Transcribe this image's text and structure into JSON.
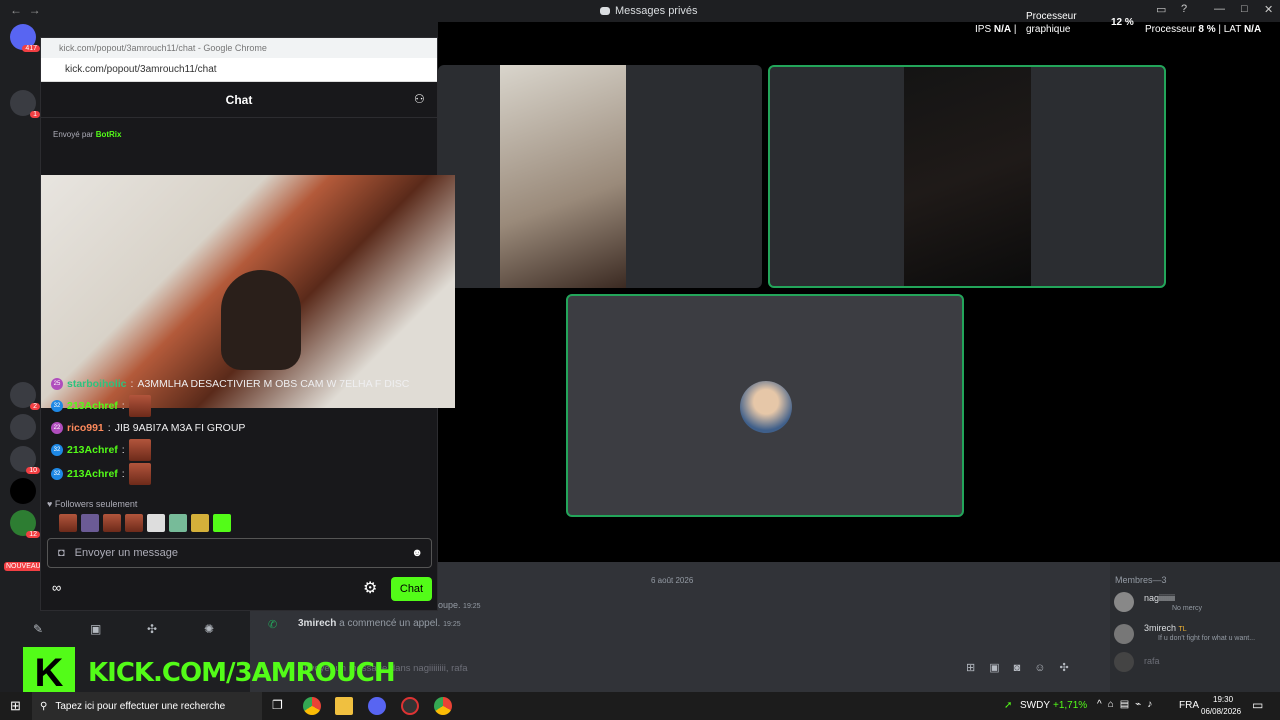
{
  "discord": {
    "title": "Messages privés",
    "perf": {
      "ips_label": "IPS",
      "ips_value": "N/A",
      "gpu_label": "Processeur",
      "gpu_sub": "graphique",
      "gpu_value": "12 %",
      "cpu_label": "Processeur",
      "cpu_value": "8 %",
      "lat_label": "LAT",
      "lat_value": "N/A"
    },
    "date_divider": "6 août 2026",
    "messages": [
      {
        "text": "oupe.",
        "time": "19:25"
      },
      {
        "user": "3mirech",
        "text": " a commencé un appel.",
        "time": "19:25"
      }
    ],
    "input_placeholder": "Envoyer un message dans nagiiiiiiii, rafa",
    "members_header": "Membres—3",
    "members": [
      {
        "name": "nagiiiiiiii",
        "status": "No mercy"
      },
      {
        "name": "3mirech",
        "tag": "TL",
        "status": "If u don't fight for what u want..."
      },
      {
        "name": "rafa",
        "status": ""
      }
    ],
    "server_badges": [
      "417",
      "1",
      "2",
      "10",
      "12",
      "NOUVEAU"
    ]
  },
  "chrome": {
    "window_title": "kick.com/popout/3amrouch11/chat - Google Chrome",
    "url": "kick.com/popout/3amrouch11/chat",
    "chat_header": "Chat",
    "pinned_partial": "Envoyé par",
    "pinned_user": "BotRix",
    "chat": [
      {
        "user": "starboiholic",
        "badge": "25",
        "color": "#2ec27e",
        "text": "A3MMLHA DESACTIVIER M OBS CAM W 7ELHA F DISC",
        "emote": false
      },
      {
        "user": "213Achref",
        "badge": "32",
        "color": "#53fc18",
        "text": "",
        "emote": true
      },
      {
        "user": "rico991",
        "badge": "22",
        "color": "#ff8a5c",
        "text": "JIB 9ABI7A M3A FI GROUP",
        "emote": false
      },
      {
        "user": "213Achref",
        "badge": "32",
        "color": "#53fc18",
        "text": "",
        "emote": true
      },
      {
        "user": "213Achref",
        "badge": "32",
        "color": "#53fc18",
        "text": "",
        "emote": true
      }
    ],
    "followers_only": "Followers seulement",
    "message_placeholder": "Envoyer un message",
    "chat_button": "Chat"
  },
  "overlay": {
    "logo_letter": "K",
    "kick_text": "KICK.COM/3AMROUCH"
  },
  "taskbar": {
    "search": "Tapez ici pour effectuer une recherche",
    "stock_name": "SWDY",
    "stock_change": "+1,71%",
    "lang": "FRA",
    "time": "19:30",
    "date": "06/08/2026"
  }
}
